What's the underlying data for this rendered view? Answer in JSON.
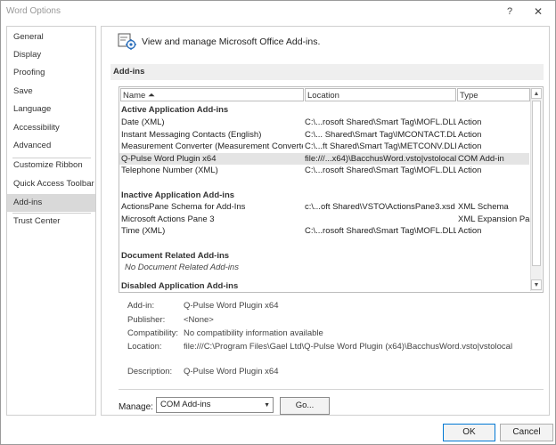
{
  "window": {
    "title": "Word Options",
    "help_glyph": "?",
    "close_glyph": "✕"
  },
  "sidebar": {
    "items": [
      {
        "label": "General"
      },
      {
        "label": "Display"
      },
      {
        "label": "Proofing"
      },
      {
        "label": "Save"
      },
      {
        "label": "Language"
      },
      {
        "label": "Accessibility"
      },
      {
        "label": "Advanced"
      },
      {
        "label": "Customize Ribbon"
      },
      {
        "label": "Quick Access Toolbar"
      },
      {
        "label": "Add-ins"
      },
      {
        "label": "Trust Center"
      }
    ],
    "selected": "Add-ins"
  },
  "header": {
    "text": "View and manage Microsoft Office Add-ins.",
    "icon": "addins-gear-icon"
  },
  "section": {
    "title": "Add-ins"
  },
  "table": {
    "columns": {
      "name": "Name ⏶",
      "location": "Location",
      "type": "Type"
    },
    "groups": {
      "active": "Active Application Add-ins",
      "inactive": "Inactive Application Add-ins",
      "document": "Document Related Add-ins",
      "disabled": "Disabled Application Add-ins"
    },
    "active_rows": [
      {
        "name": "Date (XML)",
        "location": "C:\\...rosoft Shared\\Smart Tag\\MOFL.DLL",
        "type": "Action"
      },
      {
        "name": "Instant Messaging Contacts (English)",
        "location": "C:\\... Shared\\Smart Tag\\IMCONTACT.DLL",
        "type": "Action"
      },
      {
        "name": "Measurement Converter (Measurement Converter)",
        "location": "C:\\...ft Shared\\Smart Tag\\METCONV.DLL",
        "type": "Action"
      },
      {
        "name": "Q-Pulse Word Plugin x64",
        "location": "file:///...x64)\\BacchusWord.vsto|vstolocal",
        "type": "COM Add-in"
      },
      {
        "name": "Telephone Number (XML)",
        "location": "C:\\...rosoft Shared\\Smart Tag\\MOFL.DLL",
        "type": "Action"
      }
    ],
    "inactive_rows": [
      {
        "name": "ActionsPane Schema for Add-Ins",
        "location": "c:\\...oft Shared\\VSTO\\ActionsPane3.xsd",
        "type": "XML Schema"
      },
      {
        "name": "Microsoft Actions Pane 3",
        "location": "",
        "type": "XML Expansion Pack"
      },
      {
        "name": "Time (XML)",
        "location": "C:\\...rosoft Shared\\Smart Tag\\MOFL.DLL",
        "type": "Action"
      }
    ],
    "document_note": "No Document Related Add-ins",
    "selected_row": "Q-Pulse Word Plugin x64"
  },
  "details": {
    "addin_label": "Add-in:",
    "addin_value": "Q-Pulse Word Plugin x64",
    "publisher_label": "Publisher:",
    "publisher_value": "<None>",
    "compat_label": "Compatibility:",
    "compat_value": "No compatibility information available",
    "location_label": "Location:",
    "location_value": "file:///C:\\Program Files\\Gael Ltd\\Q-Pulse Word Plugin (x64)\\BacchusWord.vsto|vstolocal",
    "description_label": "Description:",
    "description_value": "Q-Pulse Word Plugin x64"
  },
  "manage": {
    "label": "Manage:",
    "selected": "COM Add-ins",
    "go_label": "Go..."
  },
  "buttons": {
    "ok": "OK",
    "cancel": "Cancel"
  },
  "colors": {
    "selected_nav": "#d9d9d9",
    "selected_row": "#e4e4e4",
    "section_bar": "#efefef",
    "ok_border": "#0078d4"
  }
}
